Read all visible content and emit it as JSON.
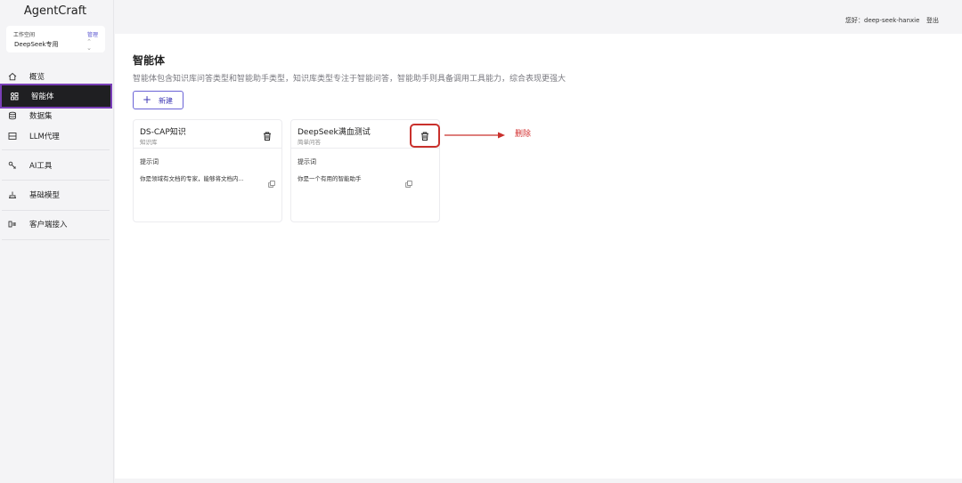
{
  "app": {
    "title": "AgentCraft"
  },
  "workspace": {
    "label": "工作空间",
    "manage": "管理",
    "value": "DeepSeek专用"
  },
  "sidebar": {
    "items": [
      {
        "label": "概览",
        "icon": "home-icon"
      },
      {
        "label": "智能体",
        "icon": "agent-icon",
        "active": true
      },
      {
        "label": "数据集",
        "icon": "database-icon"
      },
      {
        "label": "LLM代理",
        "icon": "proxy-icon"
      },
      {
        "label": "AI工具",
        "icon": "tool-icon"
      },
      {
        "label": "基础模型",
        "icon": "model-icon"
      },
      {
        "label": "客户端接入",
        "icon": "client-icon"
      }
    ]
  },
  "topbar": {
    "greeting": "您好：deep-seek-hanxie",
    "logout": "登出"
  },
  "main": {
    "title": "智能体",
    "description": "智能体包含知识库问答类型和智能助手类型，知识库类型专注于智能问答，智能助手则具备调用工具能力，综合表现更强大",
    "new_button": "新建",
    "cards": [
      {
        "title": "DS-CAP知识",
        "type": "知识库",
        "section": "提示词",
        "prompt": "你是领域有文档的专家，能够将文档内..."
      },
      {
        "title": "DeepSeek满血测试",
        "type": "简单问答",
        "section": "提示词",
        "prompt": "你是一个有用的智能助手"
      }
    ]
  },
  "annotation": {
    "label": "删除",
    "color": "#d33030"
  },
  "colors": {
    "accent": "#5b57d1",
    "active_bg": "#1f1f22",
    "active_outline": "#7a3fb8"
  }
}
